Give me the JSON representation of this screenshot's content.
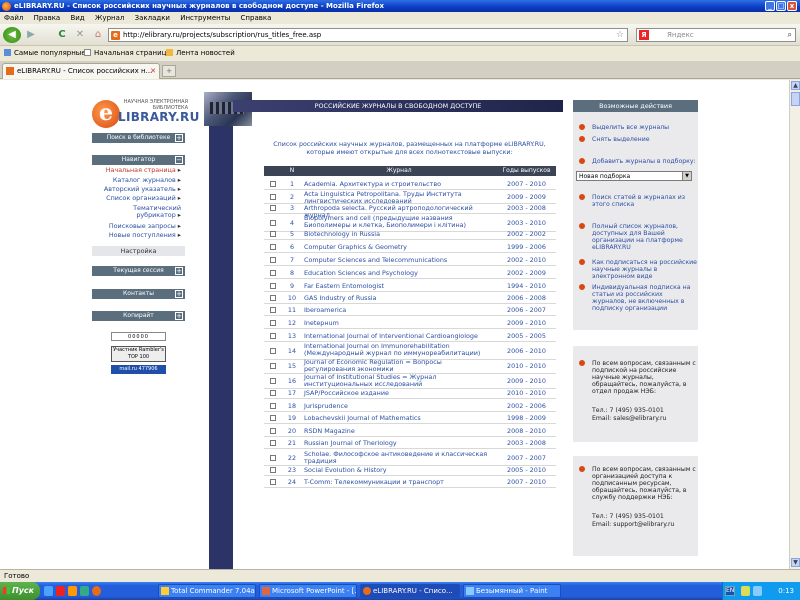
{
  "window": {
    "title": "eLIBRARY.RU - Список российских научных журналов в свободном доступе - Mozilla Firefox",
    "buttons": [
      "_",
      "□",
      "x"
    ]
  },
  "menu": [
    "Файл",
    "Правка",
    "Вид",
    "Журнал",
    "Закладки",
    "Инструменты",
    "Справка"
  ],
  "nav": {
    "back": "◀",
    "forward": "▶",
    "reload": "C",
    "stop": "✕",
    "home": "⌂",
    "url": "http://elibrary.ru/projects/subscription/rus_titles_free.asp",
    "search_placeholder": "Яндекс"
  },
  "bookmarks": [
    "Самые популярные",
    "Начальная страница",
    "Лента новостей"
  ],
  "tabs": [
    {
      "label": "eLIBRARY.RU - Список российских н..."
    }
  ],
  "page": {
    "logo_sub": "научная электронная библиотека",
    "logo_main": "LIBRARY.RU",
    "logo_e": "e",
    "search_box": "Поиск в библиотеке",
    "navigator": "Навигатор",
    "nav_links": [
      "Начальная страница",
      "Каталог журналов",
      "Авторский указатель",
      "Список организаций",
      "Тематический рубрикатор",
      "Поисковые запросы",
      "Новые поступления"
    ],
    "settings": "Настройка",
    "session": "Текущая сессия",
    "contacts": "Контакты",
    "copyright": "Копирайт",
    "counter1": "00000",
    "counter2": "Участник Rambler's TOP 100",
    "counter3": "mail.ru 477906",
    "center_title": "РОССИЙСКИЕ ЖУРНАЛЫ В СВОБОДНОМ ДОСТУПЕ",
    "intro": "Список российских научных журналов, размещенных на платформе eLIBRARY.RU, которые имеют открытые для всех полнотекстовые выпуски:",
    "table_headers": {
      "num": "N",
      "title": "Журнал",
      "years": "Годы выпусков"
    },
    "journals": [
      {
        "num": "1",
        "title": "Academia. Архитектура и строительство",
        "years": "2007 - 2010"
      },
      {
        "num": "2",
        "title": "Acta Linguistica Petropolitana. Труды Института лингвистических исследований",
        "years": "2009 - 2009"
      },
      {
        "num": "3",
        "title": "Arthropoda selecta. Русский артроподологический журнал",
        "years": "2003 - 2008"
      },
      {
        "num": "4",
        "title": "Biopolymers and cell (предыдущие названия Биополимеры и клетка, Биополимери і клітина)",
        "years": "2003 - 2010"
      },
      {
        "num": "5",
        "title": "Biotechnology in Russia",
        "years": "2002 - 2002"
      },
      {
        "num": "6",
        "title": "Computer Graphics & Geometry",
        "years": "1999 - 2006"
      },
      {
        "num": "7",
        "title": "Computer Sciences and Telecommunications",
        "years": "2002 - 2010"
      },
      {
        "num": "8",
        "title": "Education Sciences and Psychology",
        "years": "2002 - 2009"
      },
      {
        "num": "9",
        "title": "Far Eastern Entomologist",
        "years": "1994 - 2010"
      },
      {
        "num": "10",
        "title": "GAS Industry of Russia",
        "years": "2006 - 2008"
      },
      {
        "num": "11",
        "title": "Iberoamerica",
        "years": "2006 - 2007"
      },
      {
        "num": "12",
        "title": "Inetернum",
        "years": "2009 - 2010"
      },
      {
        "num": "13",
        "title": "International Journal of Interventional Cardioangiologe",
        "years": "2005 - 2005"
      },
      {
        "num": "14",
        "title": "International Journal on Immunorehabilitation (Международный журнал по иммунореабилитации)",
        "years": "2006 - 2010"
      },
      {
        "num": "15",
        "title": "Journal of Economic Regulation = Вопросы регулирования экономики",
        "years": "2010 - 2010"
      },
      {
        "num": "16",
        "title": "Journal of Institutional Studies = Журнал институциональных исследований",
        "years": "2009 - 2010"
      },
      {
        "num": "17",
        "title": "JSAP/Российское издание",
        "years": "2010 - 2010"
      },
      {
        "num": "18",
        "title": "Jurisprudence",
        "years": "2002 - 2006"
      },
      {
        "num": "19",
        "title": "Lobachevskii Journal of Mathematics",
        "years": "1998 - 2009"
      },
      {
        "num": "20",
        "title": "RSDN Magazine",
        "years": "2008 - 2010"
      },
      {
        "num": "21",
        "title": "Russian Journal of Theriology",
        "years": "2003 - 2008"
      },
      {
        "num": "22",
        "title": "Scholae. Философское антиковедение и классическая традиция",
        "years": "2007 - 2007"
      },
      {
        "num": "23",
        "title": "Social Evolution & History",
        "years": "2005 - 2010"
      },
      {
        "num": "24",
        "title": "T-Comm: Телекоммуникации и транспорт",
        "years": "2007 - 2010"
      }
    ],
    "actions_title": "Возможные действия",
    "actions": [
      "Выделить все журналы",
      "Снять выделение"
    ],
    "add_label": "Добавить журналы в подборку:",
    "dropdown": "Новая подборка",
    "links": [
      "Поиск статей в журналах из этого списка",
      "Полный список журналов, доступных для Вашей организации на платформе eLIBRARY.RU",
      "Как подписаться на российские научные журналы в электронном виде",
      "Индивидуальная подписка на статьи из российских журналов, не включенных в подписку организации"
    ],
    "contact1": {
      "text": "По всем вопросам, связанным с подпиской на российские научные журналы, обращайтесь, пожалуйста, в отдел продаж НЭБ:",
      "tel": "Тел.: 7 (495) 935-0101",
      "email": "Email: sales@elibrary.ru"
    },
    "contact2": {
      "text": "По всем вопросам, связанным с организацией доступа к подписанным ресурсам, обращайтесь, пожалуйста, в службу поддержки НЭБ:",
      "tel": "Тел.: 7 (495) 935-0101",
      "email": "Email: support@elibrary.ru"
    }
  },
  "status": "Готово",
  "taskbar": {
    "start": "Пуск",
    "tasks": [
      "Total Commander 7.04a ...",
      "Microsoft PowerPoint - [...",
      "eLIBRARY.RU - Списо...",
      "Безымянный - Paint"
    ],
    "lang": "EN",
    "clock": "0:13"
  },
  "colors": {
    "accent": "#2b4fa3",
    "header_dark": "#3b4454",
    "orange": "#d9480f"
  }
}
